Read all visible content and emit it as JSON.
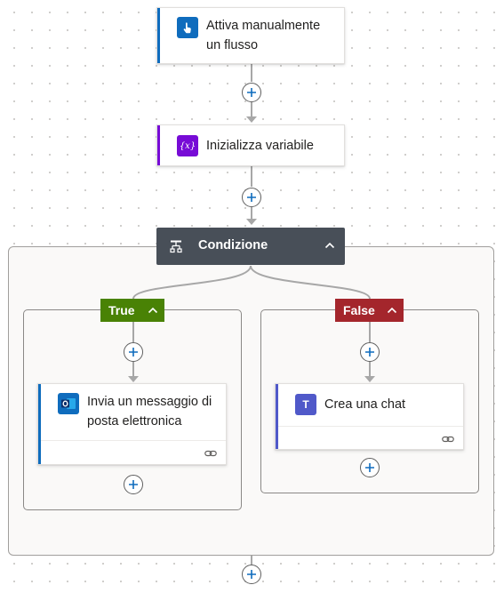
{
  "flow": {
    "trigger": {
      "title_line1": "Attiva manualmente",
      "title_line2": "un flusso",
      "color": "#0f6cbd"
    },
    "init_variable": {
      "title": "Inizializza variabile",
      "color": "#770bd6",
      "icon_text": "{x}"
    },
    "condition": {
      "title": "Condizione",
      "header_color": "#484f58"
    },
    "true_branch": {
      "label": "True",
      "color": "#498205",
      "action": {
        "title_line1": "Invia un messaggio di",
        "title_line2": "posta elettronica",
        "color": "#0f6cbd"
      }
    },
    "false_branch": {
      "label": "False",
      "color": "#a4262c",
      "action": {
        "title": "Crea una chat",
        "color": "#5059c9",
        "icon_letter": "T"
      }
    }
  },
  "icons": {
    "trigger": "hand-tap-icon",
    "variable": "variable-icon",
    "condition": "condition-icon",
    "outlook": "outlook-icon",
    "teams": "teams-icon",
    "link": "link-icon",
    "add": "plus-icon",
    "collapse": "chevron-up-icon"
  }
}
